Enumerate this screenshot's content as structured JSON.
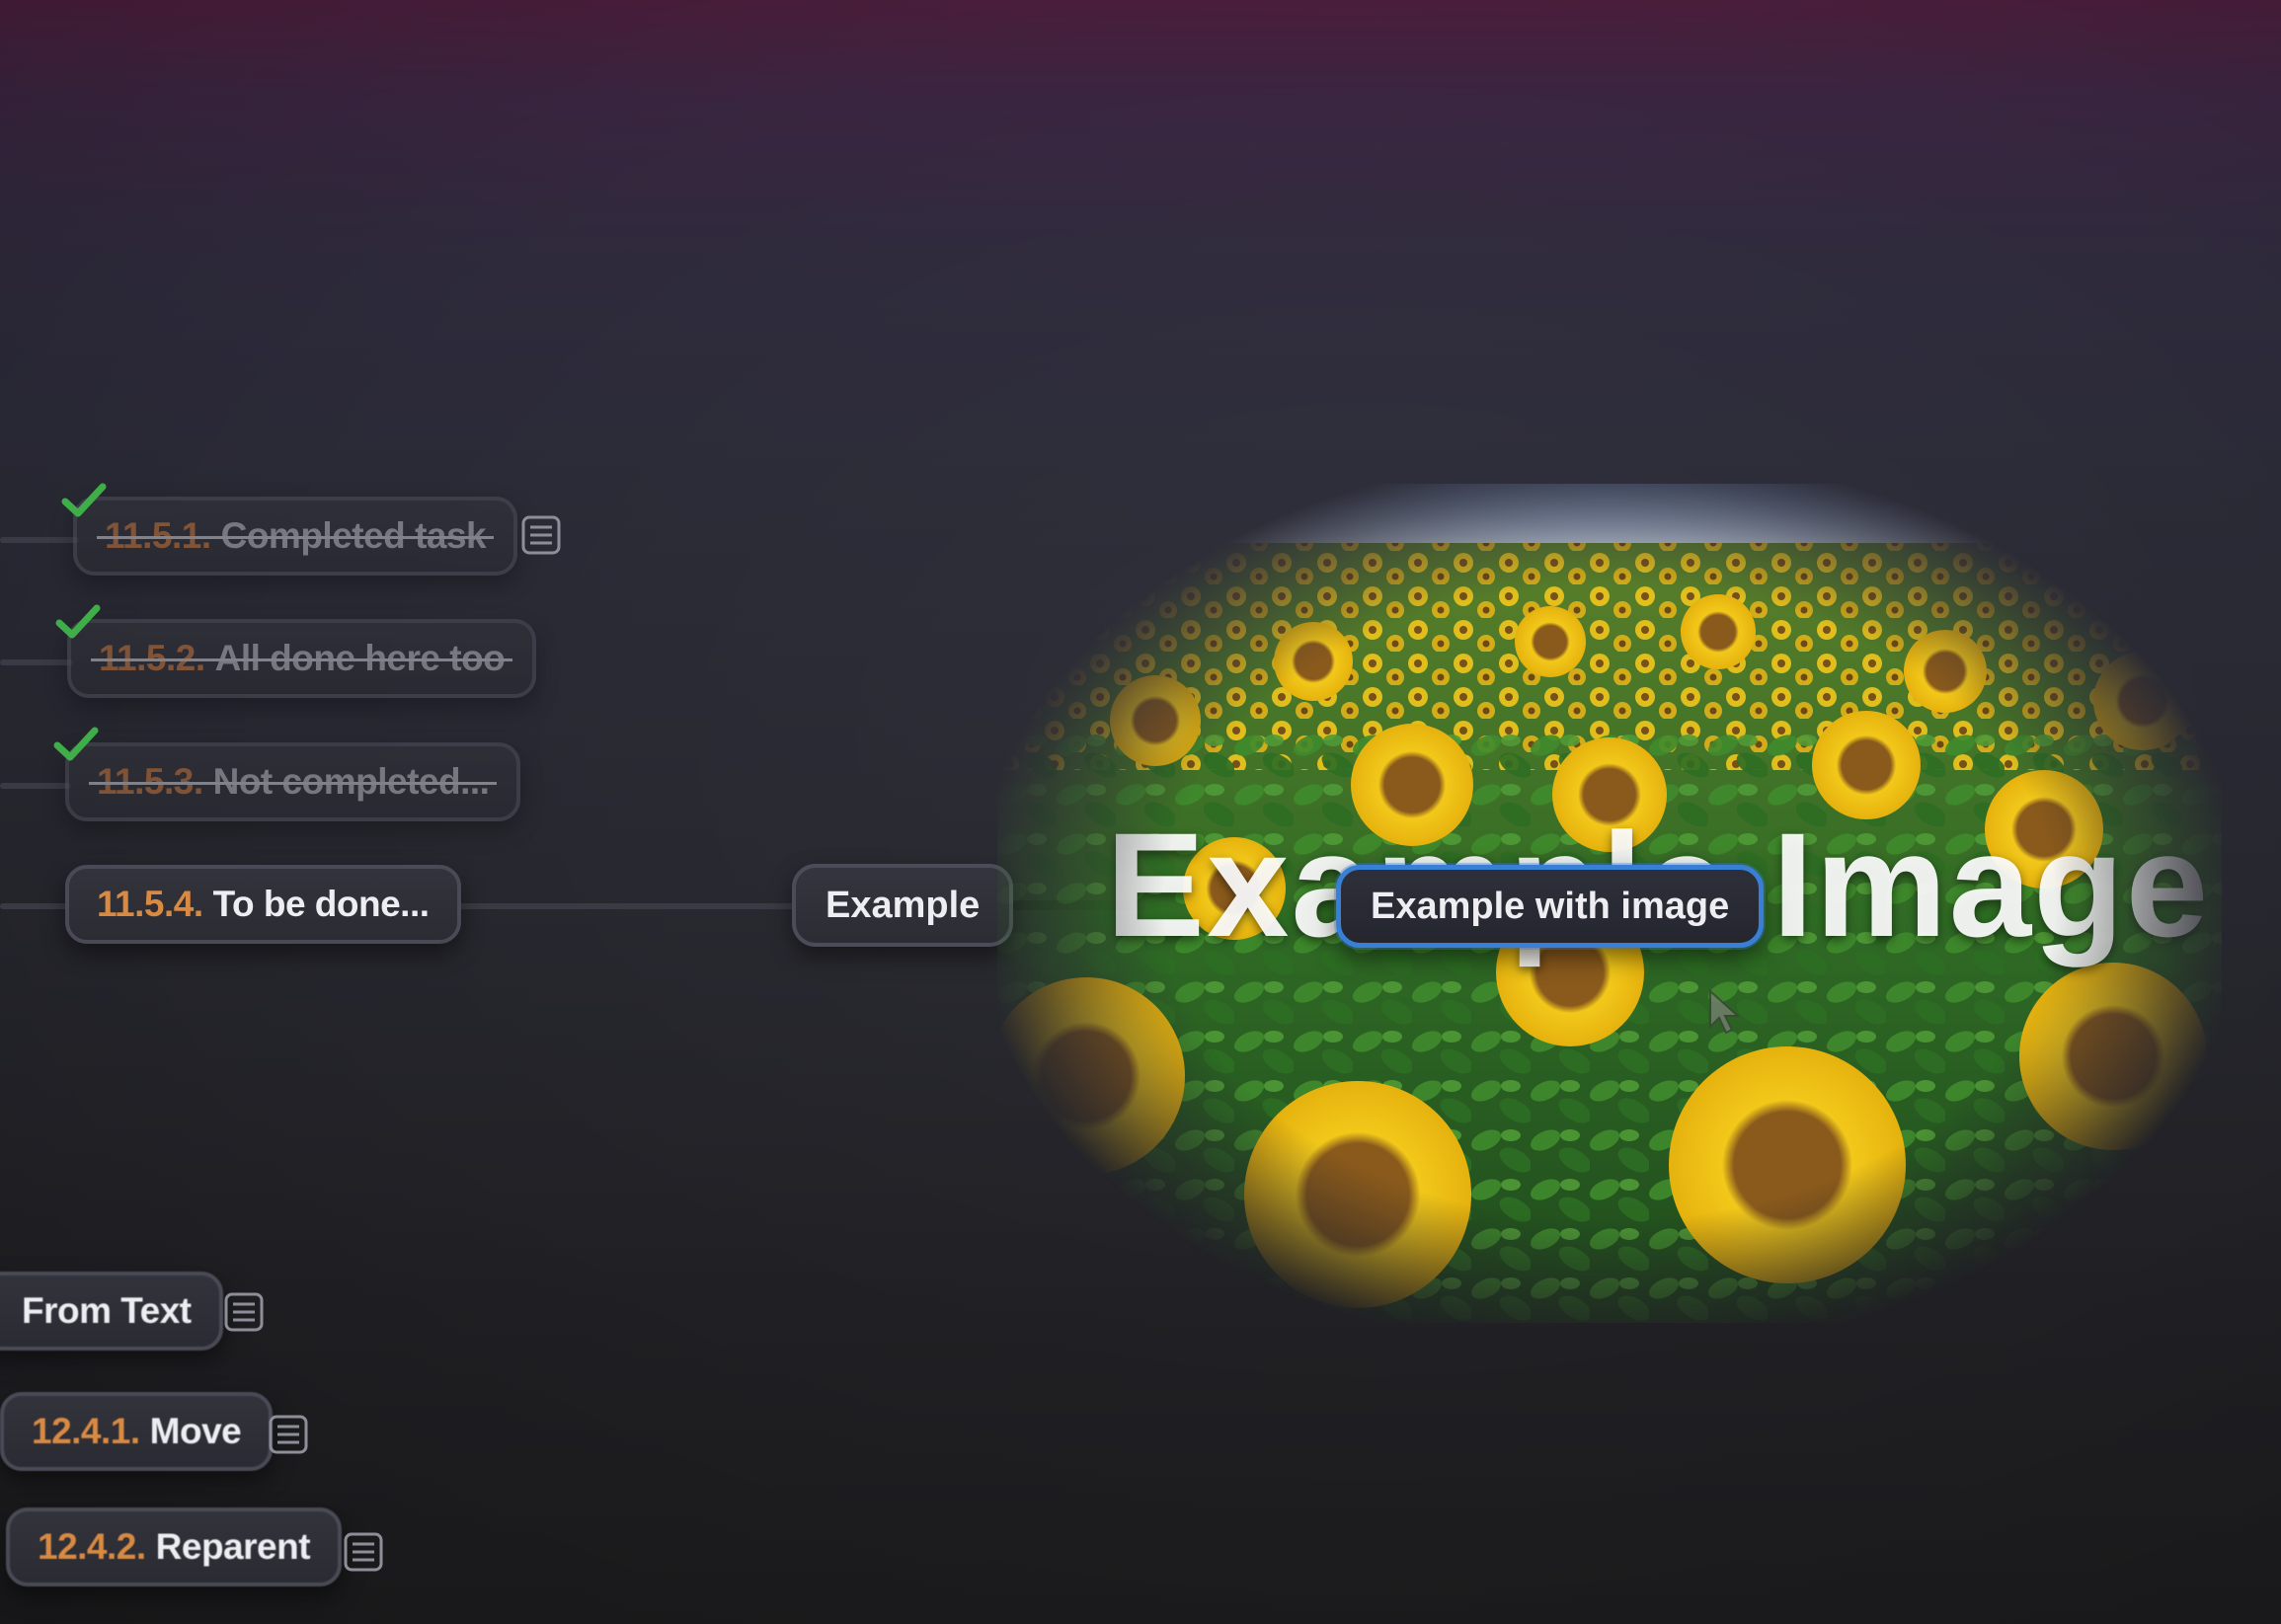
{
  "tasks": [
    {
      "number": "11.5.1.",
      "label": "Completed task",
      "completed": true,
      "has_note": true
    },
    {
      "number": "11.5.2.",
      "label": "All done here too",
      "completed": true,
      "has_note": false
    },
    {
      "number": "11.5.3.",
      "label": "Not completed...",
      "completed": true,
      "has_note": false
    },
    {
      "number": "11.5.4.",
      "label": "To be done...",
      "completed": false,
      "has_note": false
    }
  ],
  "example_node": {
    "label": "Example"
  },
  "image_node": {
    "label": "Example with image",
    "selected": true,
    "image_caption": "Example Image"
  },
  "lower_nodes": [
    {
      "number": "",
      "label": "From Text",
      "has_note": true
    },
    {
      "number": "12.4.1.",
      "label": "Move",
      "has_note": true
    },
    {
      "number": "12.4.2.",
      "label": "Reparent",
      "has_note": true
    }
  ],
  "colors": {
    "accent_number": "#d88a42",
    "check": "#3fae48",
    "selection": "#3a7fd6",
    "node_border": "#4a4a56"
  },
  "icons": {
    "check": "check-icon",
    "note": "note-icon",
    "cursor": "cursor-arrow-icon"
  }
}
